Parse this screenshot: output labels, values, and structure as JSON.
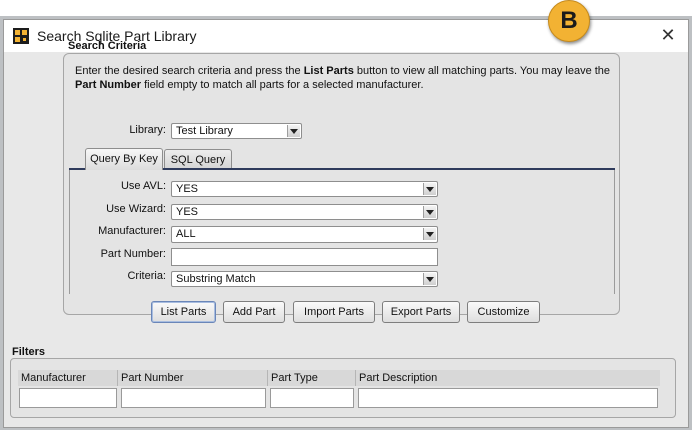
{
  "window": {
    "title": "Search Sqlite Part Library",
    "close_glyph": "✕",
    "callout": "B"
  },
  "criteria": {
    "heading": "Search Criteria",
    "instructions": {
      "text1": "Enter the desired search criteria and press the ",
      "bold1": "List Parts",
      "text2": " button to view all matching parts. You may leave the ",
      "bold2": "Part Number",
      "text3": " field empty to match all parts for a selected manufacturer."
    },
    "library": {
      "label": "Library:",
      "value": "Test Library"
    },
    "tabs": [
      {
        "label": "Query By Key",
        "active": true
      },
      {
        "label": "SQL Query",
        "active": false
      }
    ],
    "fields": {
      "use_avl": {
        "label": "Use AVL:",
        "value": "YES"
      },
      "use_wizard": {
        "label": "Use Wizard:",
        "value": "YES"
      },
      "manufacturer": {
        "label": "Manufacturer:",
        "value": "ALL"
      },
      "part_number": {
        "label": "Part Number:",
        "value": ""
      },
      "criteria": {
        "label": "Criteria:",
        "value": "Substring Match"
      }
    },
    "buttons": {
      "list_parts": "List Parts",
      "add_part": "Add Part",
      "import_parts": "Import Parts",
      "export_parts": "Export Parts",
      "customize": "Customize"
    }
  },
  "filters": {
    "heading": "Filters",
    "columns": [
      "Manufacturer",
      "Part Number",
      "Part Type",
      "Part Description"
    ],
    "values": [
      "",
      "",
      "",
      ""
    ]
  },
  "colors": {
    "badge": "#f2b233",
    "tab_underline": "#2f3b5c",
    "window_bg": "#e8e8e8"
  },
  "icons": {
    "app": "app-icon",
    "close": "close-icon",
    "dropdown": "chevron-down-icon"
  }
}
